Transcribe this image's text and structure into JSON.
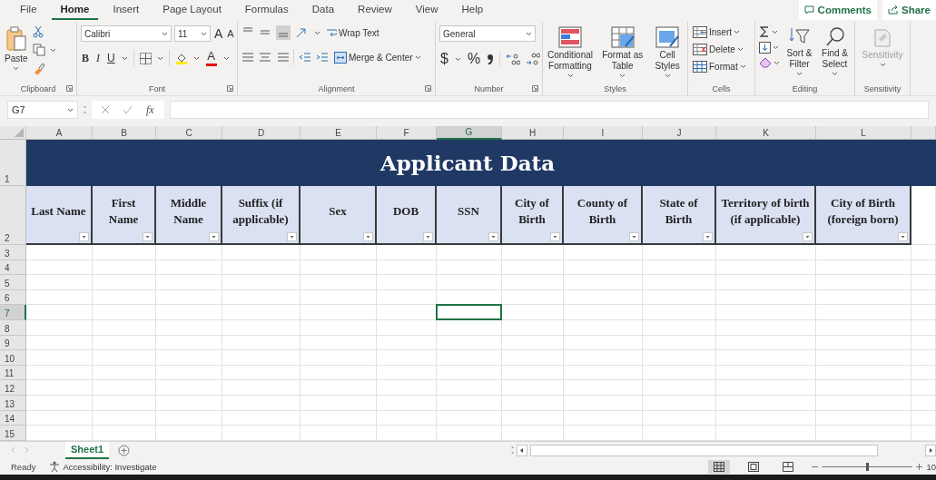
{
  "menu_tabs": [
    {
      "label": "File",
      "selected": false
    },
    {
      "label": "Home",
      "selected": true
    },
    {
      "label": "Insert",
      "selected": false
    },
    {
      "label": "Page Layout",
      "selected": false
    },
    {
      "label": "Formulas",
      "selected": false
    },
    {
      "label": "Data",
      "selected": false
    },
    {
      "label": "Review",
      "selected": false
    },
    {
      "label": "View",
      "selected": false
    },
    {
      "label": "Help",
      "selected": false
    }
  ],
  "top_buttons": [
    "Comments",
    "Share"
  ],
  "ribbon": {
    "groups": [
      {
        "kind": "clipboard",
        "label": "Clipboard",
        "paste": "Paste"
      },
      {
        "kind": "font",
        "label": "Font",
        "font_name": "Calibri",
        "font_size": "11",
        "grow": "A",
        "shrink": "A",
        "bold": "B",
        "italic": "I",
        "underline": "U",
        "font_color": "A"
      },
      {
        "kind": "alignment",
        "label": "Alignment",
        "wrap": "Wrap Text",
        "merge": "Merge & Center"
      },
      {
        "kind": "number",
        "label": "Number",
        "format": "General",
        "currency": "$",
        "percent": "%"
      },
      {
        "kind": "styles",
        "label": "Styles",
        "buttons": [
          "Conditional Formatting",
          "Format as Table",
          "Cell Styles"
        ]
      },
      {
        "kind": "cells",
        "label": "Cells",
        "buttons": [
          "Insert",
          "Delete",
          "Format"
        ]
      },
      {
        "kind": "editing",
        "label": "Editing",
        "buttons": [
          "Sort & Filter",
          "Find & Select"
        ]
      },
      {
        "kind": "sensitivity",
        "label": "Sensitivity",
        "button": "Sensitivity",
        "disabled": true
      }
    ]
  },
  "formula_bar": {
    "name_box": "G7",
    "function_label": "fx"
  },
  "sheet": {
    "title": "Applicant Data",
    "columns": [
      {
        "letter": "A",
        "header": "Last Name",
        "selected": false
      },
      {
        "letter": "B",
        "header": "First Name",
        "selected": false
      },
      {
        "letter": "C",
        "header": "Middle Name",
        "selected": false
      },
      {
        "letter": "D",
        "header": "Suffix (if applicable)",
        "selected": false
      },
      {
        "letter": "E",
        "header": "Sex",
        "selected": false
      },
      {
        "letter": "F",
        "header": "DOB",
        "selected": false
      },
      {
        "letter": "G",
        "header": "SSN",
        "selected": true
      },
      {
        "letter": "H",
        "header": "City of Birth",
        "selected": false
      },
      {
        "letter": "I",
        "header": "County of Birth",
        "selected": false
      },
      {
        "letter": "J",
        "header": "State of Birth",
        "selected": false
      },
      {
        "letter": "K",
        "header": "Territory of birth (if applicable)",
        "selected": false
      },
      {
        "letter": "L",
        "header": "City of Birth (foreign born)",
        "selected": false
      }
    ],
    "rows": [
      {
        "number": "1",
        "selected": false
      },
      {
        "number": "2",
        "selected": false
      },
      {
        "number": "3",
        "selected": false
      },
      {
        "number": "4",
        "selected": false
      },
      {
        "number": "5",
        "selected": false
      },
      {
        "number": "6",
        "selected": false
      },
      {
        "number": "7",
        "selected": true
      },
      {
        "number": "8",
        "selected": false
      },
      {
        "number": "9",
        "selected": false
      },
      {
        "number": "10",
        "selected": false
      },
      {
        "number": "11",
        "selected": false
      },
      {
        "number": "12",
        "selected": false
      },
      {
        "number": "13",
        "selected": false
      },
      {
        "number": "14",
        "selected": false
      },
      {
        "number": "15",
        "selected": false
      }
    ]
  },
  "sheet_tabs": [
    {
      "label": "Sheet1",
      "selected": true
    }
  ],
  "status_bar": {
    "status": "Ready",
    "accessibility": "Accessibility: Investigate",
    "zoom": {
      "level": 0.5,
      "reading": "10"
    }
  }
}
